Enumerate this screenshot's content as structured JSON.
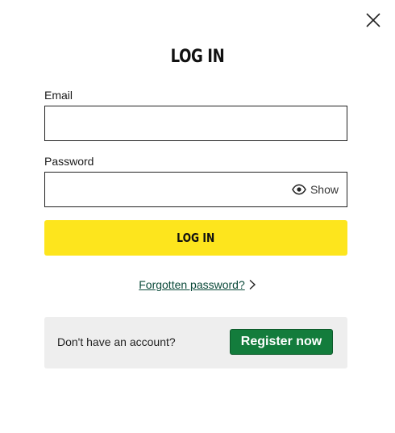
{
  "dialog": {
    "title": "LOG IN",
    "close_icon": "close-icon"
  },
  "email": {
    "label": "Email",
    "value": "",
    "placeholder": ""
  },
  "password": {
    "label": "Password",
    "value": "",
    "placeholder": "",
    "show_label": "Show",
    "show_icon": "eye-icon"
  },
  "login_button": {
    "label": "LOG IN",
    "color": "#fde51d"
  },
  "forgot": {
    "label": "Forgotten password?",
    "icon": "chevron-right-icon"
  },
  "register": {
    "prompt": "Don't have an account?",
    "button_label": "Register now",
    "button_color": "#137c3c"
  }
}
